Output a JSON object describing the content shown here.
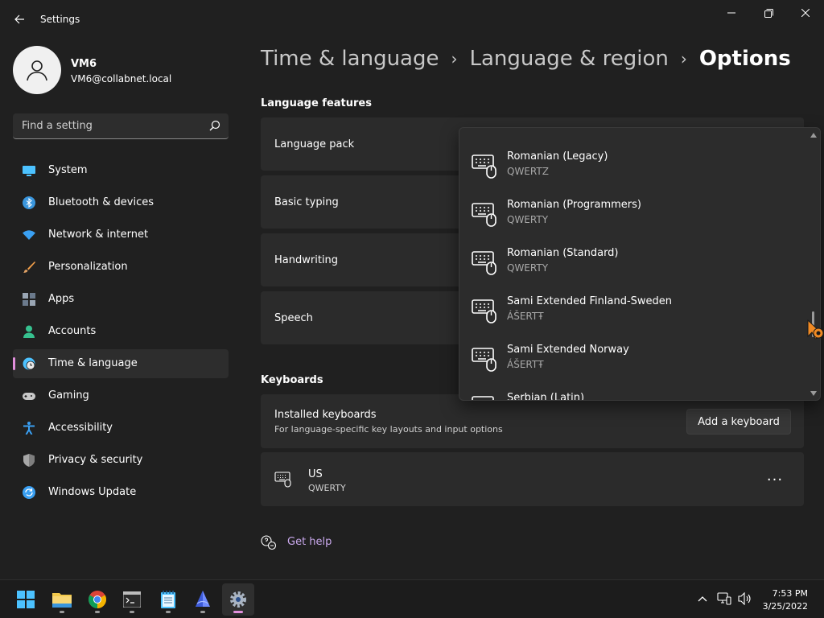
{
  "window": {
    "title": "Settings"
  },
  "user": {
    "name": "VM6",
    "email": "VM6@collabnet.local"
  },
  "search": {
    "placeholder": "Find a setting"
  },
  "sidebar": {
    "items": [
      {
        "label": "System",
        "icon": "system-icon",
        "color": "#4cc2ff"
      },
      {
        "label": "Bluetooth & devices",
        "icon": "bluetooth-icon",
        "color": "#3a96dd"
      },
      {
        "label": "Network & internet",
        "icon": "wifi-icon",
        "color": "#3aa0f3"
      },
      {
        "label": "Personalization",
        "icon": "brush-icon",
        "color": "#f4a04a"
      },
      {
        "label": "Apps",
        "icon": "apps-icon",
        "color": "#9aa6b4"
      },
      {
        "label": "Accounts",
        "icon": "accounts-icon",
        "color": "#36c18f"
      },
      {
        "label": "Time & language",
        "icon": "globe-clock-icon",
        "color": "#4cc2ff",
        "selected": true
      },
      {
        "label": "Gaming",
        "icon": "gamepad-icon",
        "color": "#c8c8c8"
      },
      {
        "label": "Accessibility",
        "icon": "accessibility-icon",
        "color": "#3aa0f3"
      },
      {
        "label": "Privacy & security",
        "icon": "shield-icon",
        "color": "#a7a7a7"
      },
      {
        "label": "Windows Update",
        "icon": "update-icon",
        "color": "#3aa0f3"
      }
    ]
  },
  "breadcrumb": [
    "Time & language",
    "Language & region",
    "Options"
  ],
  "sections": {
    "language_features": {
      "title": "Language features",
      "items": [
        "Language pack",
        "Basic typing",
        "Handwriting",
        "Speech"
      ]
    },
    "keyboards": {
      "title": "Keyboards",
      "installed_title": "Installed keyboards",
      "installed_subtitle": "For language-specific key layouts and input options",
      "add_button": "Add a keyboard",
      "current": {
        "name": "US",
        "layout": "QWERTY"
      },
      "more_label": "···"
    }
  },
  "get_help": "Get help",
  "dropdown": {
    "scroll_fraction": 0.72,
    "items": [
      {
        "name": "Romanian (Legacy)",
        "layout": "QWERTZ"
      },
      {
        "name": "Romanian (Programmers)",
        "layout": "QWERTY"
      },
      {
        "name": "Romanian (Standard)",
        "layout": "QWERTY"
      },
      {
        "name": "Sami Extended Finland-Sweden",
        "layout": "ÁŠERTŦ"
      },
      {
        "name": "Sami Extended Norway",
        "layout": "ÁŠERTŦ"
      },
      {
        "name": "Serbian (Latin)",
        "layout": ""
      }
    ]
  },
  "taskbar": {
    "apps": [
      "start-icon",
      "file-explorer-icon",
      "chrome-icon",
      "terminal-icon",
      "notepad-icon",
      "app-icon",
      "settings-icon"
    ],
    "time": "7:53 PM",
    "date": "3/25/2022"
  },
  "colors": {
    "accent": "#e18fdc",
    "link": "#c9a8ec",
    "background": "#202020",
    "card": "#2b2b2b"
  }
}
